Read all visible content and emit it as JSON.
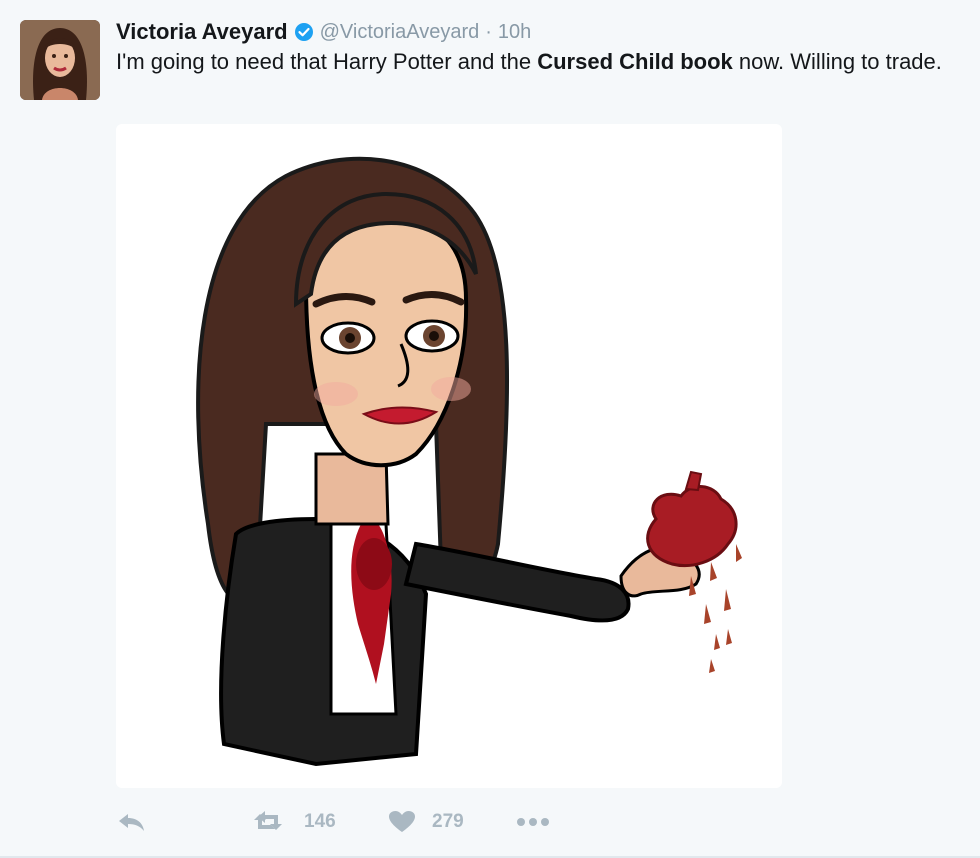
{
  "tweet": {
    "author_name": "Victoria Aveyard",
    "handle": "@VictoriaAveyard",
    "separator": "·",
    "time": "10h",
    "text_part1": "I'm going to need that Harry Potter and the ",
    "text_bold": "Cursed Child book",
    "text_part2": " now. Willing to trade."
  },
  "actions": {
    "retweet_count": "146",
    "like_count": "279"
  },
  "colors": {
    "verified": "#1da1f2",
    "action_icon": "#aab8c2",
    "handle": "#8899a6"
  },
  "icons": [
    "reply-icon",
    "retweet-icon",
    "heart-icon",
    "more-icon",
    "verified-badge-icon"
  ]
}
